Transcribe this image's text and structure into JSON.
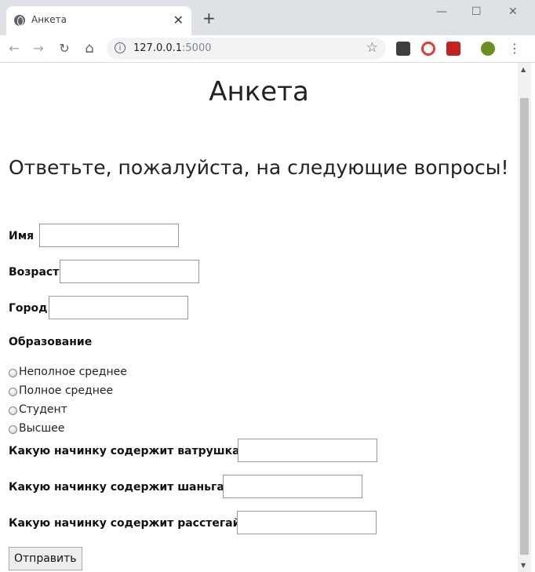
{
  "browser": {
    "tab_title": "Анкета",
    "tab_close": "✕",
    "new_tab": "+",
    "minimize": "—",
    "maximize": "☐",
    "close_window": "✕",
    "url_host": "127.0.0.1",
    "url_port": ":5000",
    "back_icon": "←",
    "forward_icon": "→",
    "reload_icon": "↻",
    "home_icon": "⌂",
    "star_icon": "☆",
    "menu_icon": "⋮",
    "info_icon": "i"
  },
  "page": {
    "title": "Анкета",
    "subtitle": "Ответьте, пожалуйста, на следующие вопросы!"
  },
  "form": {
    "name_label": "Имя",
    "age_label": "Возраст",
    "city_label": "Город",
    "education_label": "Образование",
    "education_options": [
      "Неполное среднее",
      "Полное среднее",
      "Студент",
      "Высшее"
    ],
    "q1_label": "Какую начинку содержит ватрушка?",
    "q2_label": "Какую начинку содержит шаньга?",
    "q3_label": "Какую начинку содержит расстегай?",
    "submit_label": "Отправить"
  }
}
